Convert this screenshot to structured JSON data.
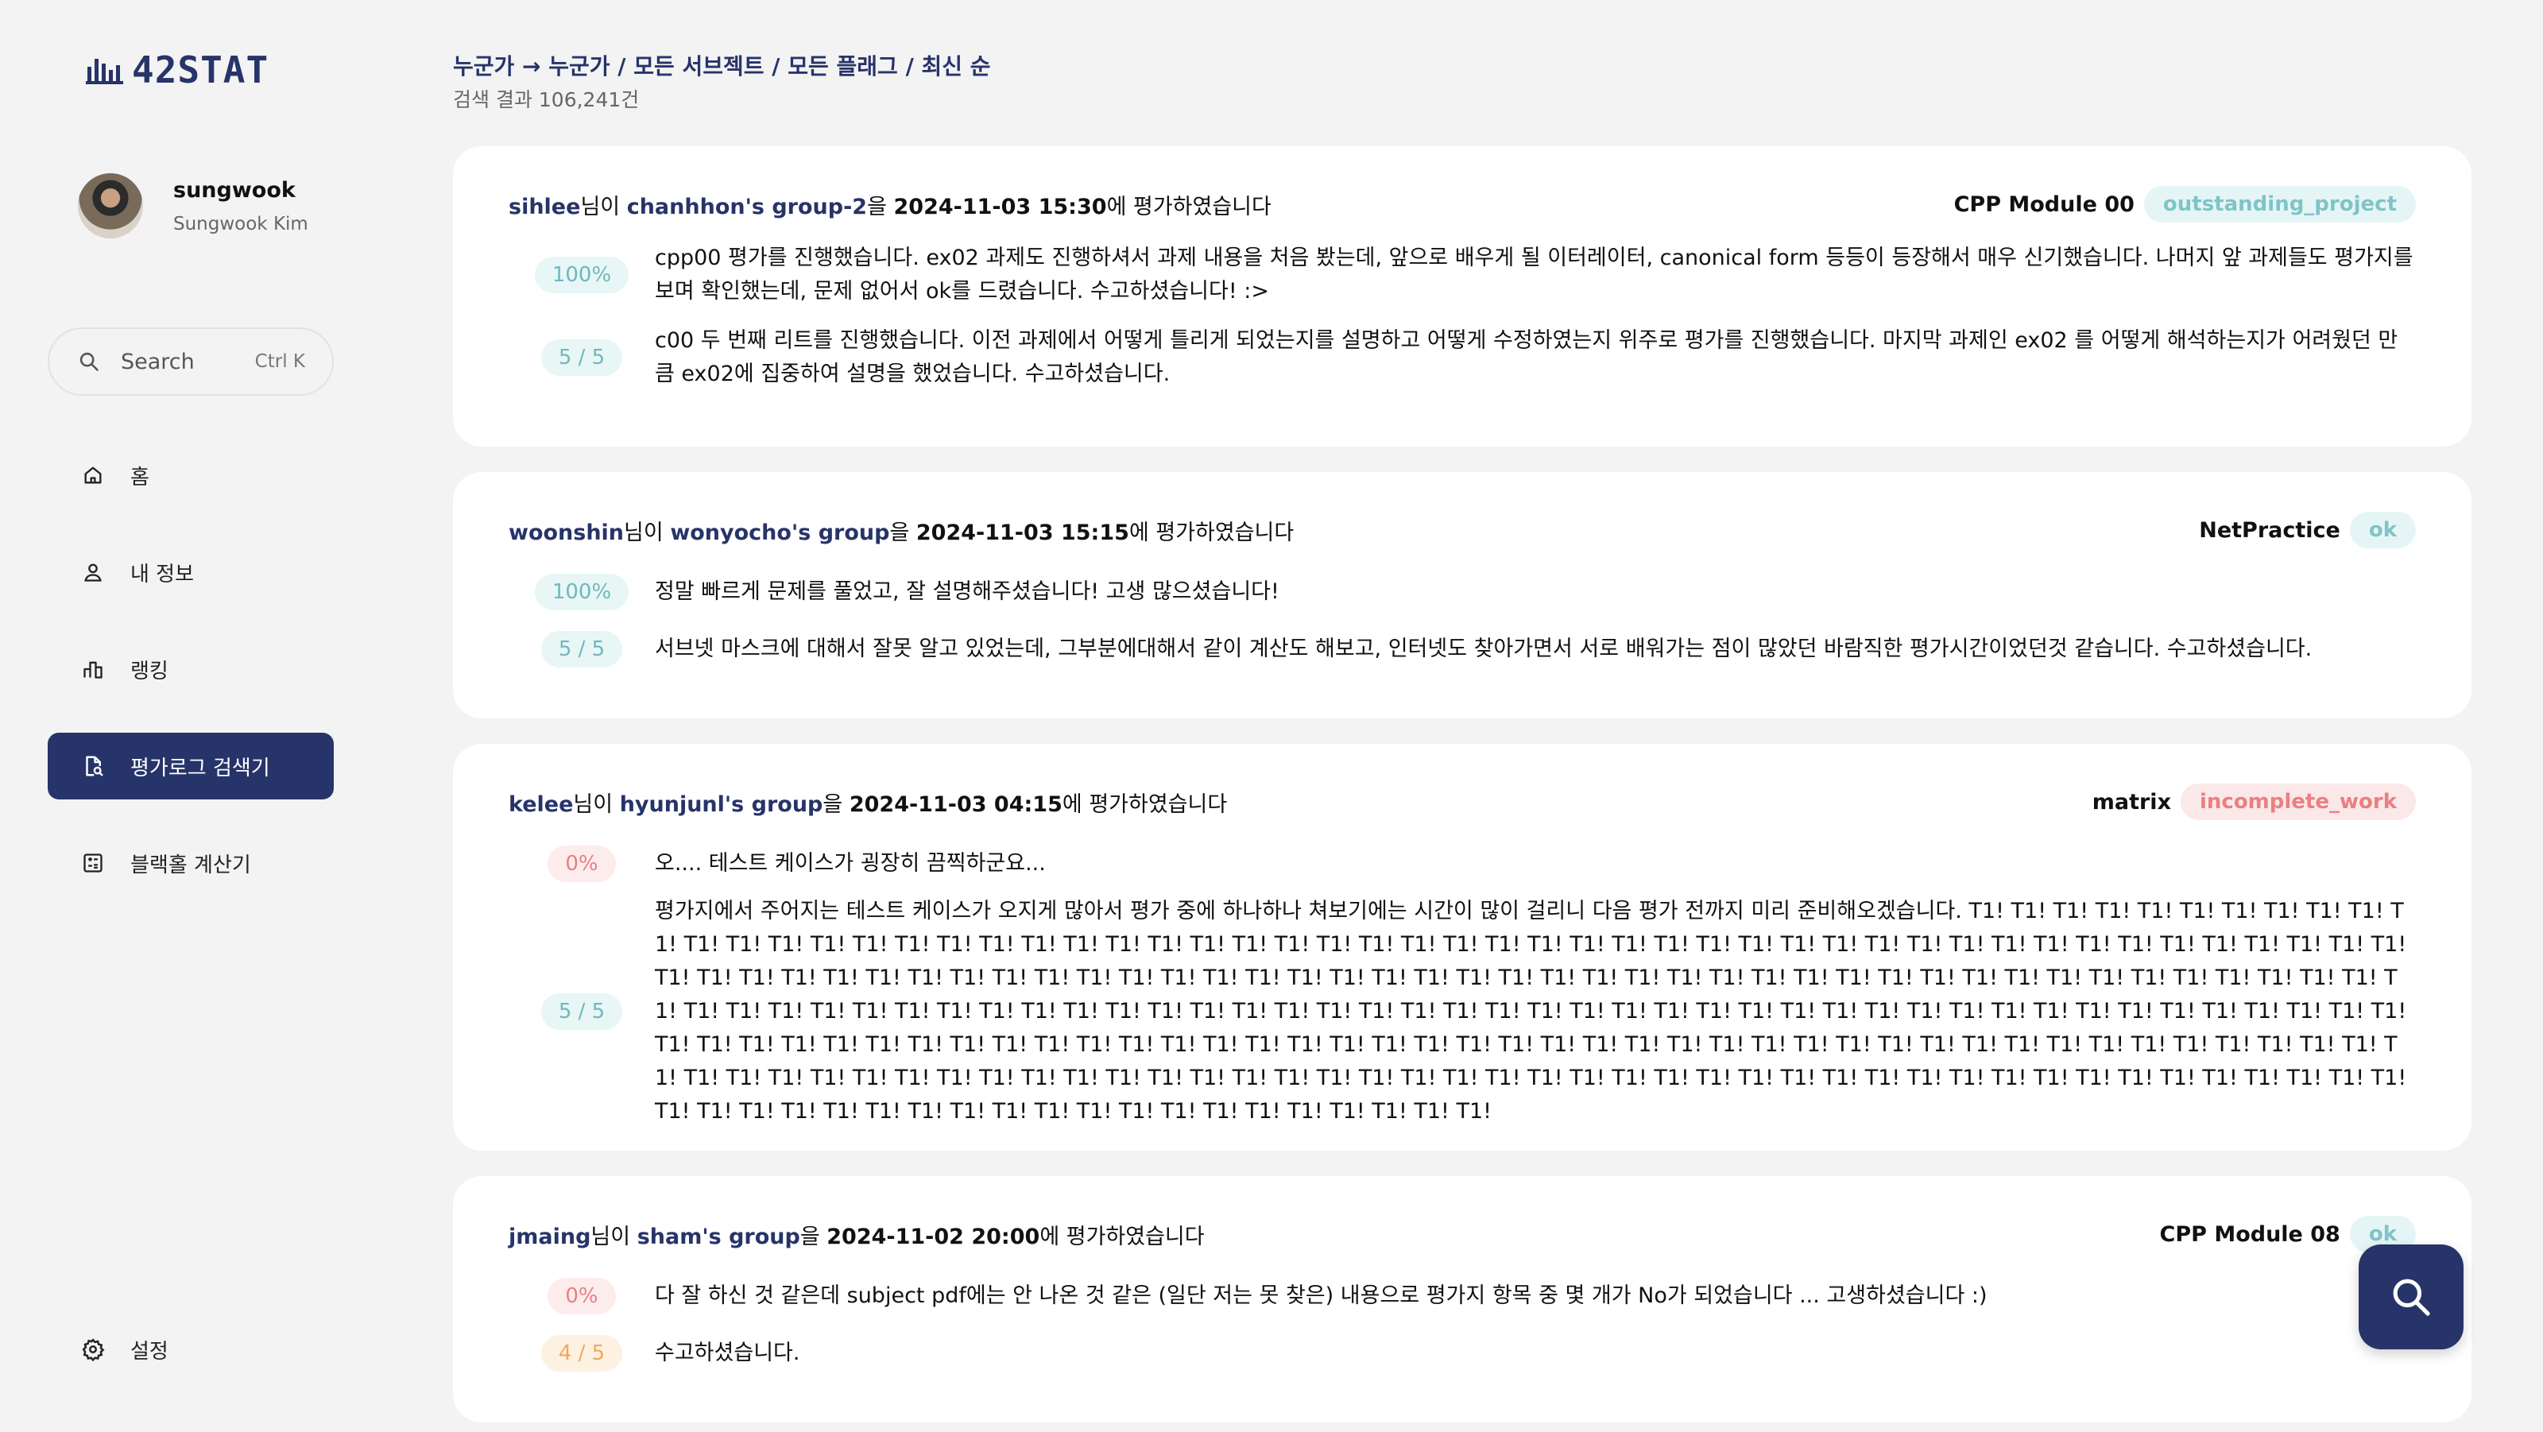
{
  "app": {
    "logo_text": "42STAT",
    "colors": {
      "primary": "#273469",
      "ok": "#7ec4c8",
      "fail": "#ea7f84",
      "partial": "#f0a862"
    }
  },
  "profile": {
    "username": "sungwook",
    "full_name": "Sungwook Kim"
  },
  "search": {
    "label": "Search",
    "shortcut": "Ctrl K"
  },
  "nav": [
    {
      "label": "홈",
      "icon": "home-icon"
    },
    {
      "label": "내 정보",
      "icon": "user-icon"
    },
    {
      "label": "랭킹",
      "icon": "ranking-icon"
    },
    {
      "label": "평가로그 검색기",
      "icon": "search-document-icon",
      "active": true
    },
    {
      "label": "블랙홀 계산기",
      "icon": "calculator-icon"
    }
  ],
  "settings": {
    "label": "설정",
    "icon": "gear-icon"
  },
  "header": {
    "breadcrumb": "누군가 → 누군가 / 모든 서브젝트 / 모든 플래그 / 최신 순",
    "result_count": "검색 결과 106,241건"
  },
  "evaluations": [
    {
      "corrector": "sihlee",
      "p1": "님이 ",
      "team": "chanhhon's group-2",
      "p2": "을 ",
      "datetime": "2024-11-03 15:30",
      "p3": "에 평가하였습니다",
      "project": "CPP Module 00",
      "flag": "outstanding_project",
      "flag_tone": "blue",
      "score_badge": "100%",
      "score_tone": "blue",
      "corrector_comment": "cpp00 평가를 진행했습니다. ex02 과제도 진행하셔서 과제 내용을 처음 봤는데, 앞으로 배우게 될 이터레이터, canonical form 등등이 등장해서 매우 신기했습니다. 나머지 앞 과제들도 평가지를 보며 확인했는데, 문제 없어서 ok를 드렸습니다. 수고하셨습니다! :>",
      "feedback_badge": "5 / 5",
      "feedback_tone": "blue",
      "feedback_comment": "c00 두 번째 리트를 진행했습니다. 이전 과제에서 어떻게 틀리게 되었는지를 설명하고 어떻게 수정하였는지 위주로 평가를 진행했습니다. 마지막 과제인 ex02 를 어떻게 해석하는지가 어려웠던 만큼 ex02에 집중하여 설명을 했었습니다. 수고하셨습니다."
    },
    {
      "corrector": "woonshin",
      "p1": "님이 ",
      "team": "wonyocho's group",
      "p2": "을 ",
      "datetime": "2024-11-03 15:15",
      "p3": "에 평가하였습니다",
      "project": "NetPractice",
      "flag": "ok",
      "flag_tone": "blue",
      "score_badge": "100%",
      "score_tone": "blue",
      "corrector_comment": "정말 빠르게 문제를 풀었고, 잘 설명해주셨습니다! 고생 많으셨습니다!",
      "feedback_badge": "5 / 5",
      "feedback_tone": "blue",
      "feedback_comment": "서브넷 마스크에 대해서 잘못 알고 있었는데, 그부분에대해서 같이 계산도 해보고, 인터넷도 찾아가면서 서로 배워가는 점이 많았던 바람직한 평가시간이었던것 같습니다. 수고하셨습니다."
    },
    {
      "corrector": "kelee",
      "p1": "님이 ",
      "team": "hyunjunl's group",
      "p2": "을 ",
      "datetime": "2024-11-03 04:15",
      "p3": "에 평가하였습니다",
      "project": "matrix",
      "flag": "incomplete_work",
      "flag_tone": "red",
      "score_badge": "0%",
      "score_tone": "red",
      "corrector_comment": "오.... 테스트 케이스가 굉장히 끔찍하군요...",
      "feedback_badge": "5 / 5",
      "feedback_tone": "blue",
      "feedback_comment": "평가지에서 주어지는 테스트 케이스가 오지게 많아서 평가 중에 하나하나 쳐보기에는 시간이 많이 걸리니 다음 평가 전까지 미리 준비해오겠습니다. T1! T1! T1! T1! T1! T1! T1! T1! T1! T1! T1! T1! T1! T1! T1! T1! T1! T1! T1! T1! T1! T1! T1! T1! T1! T1! T1! T1! T1! T1! T1! T1! T1! T1! T1! T1! T1! T1! T1! T1! T1! T1! T1! T1! T1! T1! T1! T1! T1! T1! T1! T1! T1! T1! T1! T1! T1! T1! T1! T1! T1! T1! T1! T1! T1! T1! T1! T1! T1! T1! T1! T1! T1! T1! T1! T1! T1! T1! T1! T1! T1! T1! T1! T1! T1! T1! T1! T1! T1! T1! T1! T1! T1! T1! T1! T1! T1! T1! T1! T1! T1! T1! T1! T1! T1! T1! T1! T1! T1! T1! T1! T1! T1! T1! T1! T1! T1! T1! T1! T1! T1! T1! T1! T1! T1! T1! T1! T1! T1! T1! T1! T1! T1! T1! T1! T1! T1! T1! T1! T1! T1! T1! T1! T1! T1! T1! T1! T1! T1! T1! T1! T1! T1! T1! T1! T1! T1! T1! T1! T1! T1! T1! T1! T1! T1! T1! T1! T1! T1! T1! T1! T1! T1! T1! T1! T1! T1! T1! T1! T1! T1! T1! T1! T1! T1! T1! T1! T1! T1! T1! T1! T1! T1! T1! T1! T1! T1! T1! T1! T1! T1! T1! T1! T1! T1! T1! T1! T1! T1! T1! T1! T1! T1! T1! T1! T1! T1! T1! T1! T1! T1! T1! T1! T1! T1! T1! T1! T1! T1! T1! T1! T1! T1! T1! T1! T1! T1! T1!"
    },
    {
      "corrector": "jmaing",
      "p1": "님이 ",
      "team": "sham's group",
      "p2": "을 ",
      "datetime": "2024-11-02 20:00",
      "p3": "에 평가하였습니다",
      "project": "CPP Module 08",
      "flag": "ok",
      "flag_tone": "blue",
      "score_badge": "0%",
      "score_tone": "red",
      "corrector_comment": "다 잘 하신 것 같은데 subject pdf에는 안 나온 것 같은 (일단 저는 못 찾은) 내용으로 평가지 항목 중 몇 개가 No가 되었습니다 ... 고생하셨습니다 :)",
      "feedback_badge": "4 / 5",
      "feedback_tone": "orange",
      "feedback_comment": "수고하셨습니다."
    }
  ]
}
